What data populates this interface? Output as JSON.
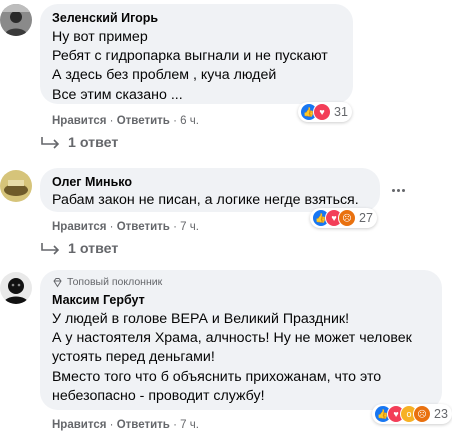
{
  "colors": {
    "like": "#1877f2",
    "love": "#f33e58",
    "wow": "#f7b125",
    "angry": "#e9710f",
    "bubble": "#f0f2f5",
    "meta": "#65676b"
  },
  "comments": [
    {
      "author": "Зеленский Игорь",
      "lines": [
        "Ну вот пример",
        "Ребят с гидропарка выгнали и не пускают",
        "А здесь без проблем , куча людей",
        "Все этим сказано ..."
      ],
      "like": "Нравится",
      "sep": "·",
      "reply": "Ответить",
      "time": "6 ч.",
      "reactions": [
        "like-icon",
        "love-icon"
      ],
      "count": "31",
      "replies": "1 ответ"
    },
    {
      "author": "Олег Минько",
      "lines": [
        "Рабам закон не писан, а логике негде взяться."
      ],
      "like": "Нравится",
      "sep": "·",
      "reply": "Ответить",
      "time": "7 ч.",
      "reactions": [
        "like-icon",
        "love-icon",
        "angry-icon"
      ],
      "count": "27",
      "replies": "1 ответ"
    },
    {
      "badge": "Топовый поклонник",
      "author": "Максим Гербут",
      "lines": [
        "У людей в голове ВЕРА и Великий Праздник!",
        "А у настоятеля Храма, алчность! Ну не может человек",
        "устоять перед деньгами!",
        "Вместо того что б объяснить прихожанам, что это",
        "небезопасно - проводит службу!"
      ],
      "like": "Нравится",
      "sep": "·",
      "reply": "Ответить",
      "time": "7 ч.",
      "reactions": [
        "like-icon",
        "love-icon",
        "wow-icon",
        "angry-icon"
      ],
      "count": "23"
    }
  ]
}
